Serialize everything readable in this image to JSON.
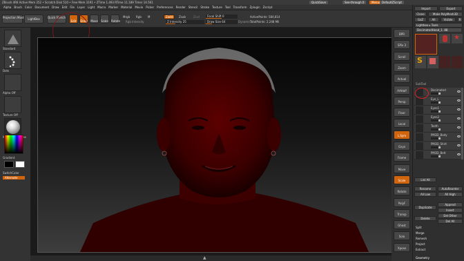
{
  "titlebar": {
    "app": "ZBrush 4R6",
    "info": "Active Mem 252 • Scratch Disk 510 • Free Mem 3191 • ZTime 1.493 RTime 11.189 Timer 14.561",
    "quicksave": "QuickSave",
    "see_through": "See-through 0",
    "menus": "Menus",
    "default_zscript": "DefaultZScript"
  },
  "menubar": {
    "items": [
      "Alpha",
      "Brush",
      "Color",
      "Document",
      "Draw",
      "Edit",
      "File",
      "Layer",
      "Light",
      "Macro",
      "Marker",
      "Material",
      "Movie",
      "Picker",
      "Preferences",
      "Render",
      "Stencil",
      "Stroke",
      "Texture",
      "Tool",
      "Transform",
      "Zplugin",
      "Zscript"
    ]
  },
  "toolbar": {
    "projection_master": "Projection Master",
    "lightbox": "LightBox",
    "quick_sketch": "Quick Sketch",
    "edit": "Edit",
    "draw": "Draw",
    "move": "Move",
    "scale": "Scale",
    "rotate": "Rotate",
    "mrgb": "Mrgb",
    "rgb": "Rgb",
    "m": "M",
    "rgb_intensity": "Rgb Intensity",
    "zadd": "Zadd",
    "zsub": "Zsub",
    "zcut": "Zcut",
    "z_intensity": "Z Intensity 25",
    "focal_shift": "Focal Shift 0",
    "draw_size": "Draw Size 64",
    "dynamic": "Dynamic",
    "active_points": "ActivePoints: 584,814",
    "total_points": "TotalPoints: 2.248 Mil"
  },
  "leftshelf": {
    "tiles": [
      "Standard",
      "Dots",
      "Alpha Off",
      "Texture Off",
      "MatCap Red Wax"
    ],
    "gradient": "Gradient",
    "switch_color": "SwitchColor",
    "alternate": "Alternate"
  },
  "rightcol": {
    "buttons": [
      "BPR",
      "SPix 3",
      "Scroll",
      "Zoom",
      "Actual",
      "AAHalf",
      "Persp",
      "Floor",
      "Local",
      "L.Sym",
      "Gxyz",
      "Frame",
      "Move",
      "Scale",
      "Rotate",
      "PolyF",
      "Transp",
      "Ghost",
      "Solo",
      "Xpose"
    ]
  },
  "palette": {
    "import": "Import",
    "export": "Export",
    "clone": "Clone",
    "make_polymesh": "Make PolyMesh3D",
    "goz": "GoZ",
    "all": "All",
    "visible": "Visible",
    "r": "R",
    "lightbox_tools": "Lightbox ▸ Tools",
    "tool_name": "DecimatedHead_1. 88",
    "tool_thumbs": [
      "DecimatedHead",
      "Cylinder3D",
      "PolyMesh3D",
      "SimpleBrush",
      "EraserBrush",
      "DecimatedHead"
    ],
    "subtool": "SubTool",
    "subtools": [
      "Decimated",
      "Eye_L",
      "Eyes1",
      "Eyes2",
      "Teeth",
      "PM3D_Body",
      "PM3D_Shirt",
      "PM3D_Belt"
    ],
    "list_all": "List All",
    "rename": "Rename",
    "auto_reorder": "AutoReorder",
    "all_low": "All Low",
    "all_high": "All High",
    "duplicate": "Duplicate",
    "append": "Append",
    "insert": "Insert",
    "delete": "Delete",
    "del_other": "Del Other",
    "del_all": "Del All",
    "split": "Split",
    "merge": "Merge",
    "remesh": "Remesh",
    "project": "Project",
    "extract": "Extract",
    "geometry": "Geometry"
  },
  "colors": {
    "accent": "#d0650e",
    "model": "#5a0000"
  }
}
